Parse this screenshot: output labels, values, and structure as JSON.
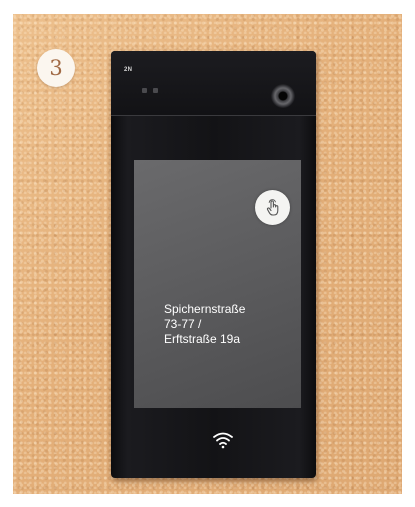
{
  "step_number": "3",
  "device": {
    "brand_mark": "2N",
    "screen": {
      "address_lines": [
        "Spichernstraße",
        "73-77 /",
        "Erftstraße 19a"
      ]
    },
    "icons": {
      "tap": "hand-tap-icon",
      "nfc": "wifi-contactless-icon"
    }
  },
  "colors": {
    "wall": "#e7b680",
    "badge_bg": "#fbf6ef",
    "badge_text": "#a16a45",
    "device_body": "#131316",
    "screen_bg": "#5c5c5e"
  }
}
